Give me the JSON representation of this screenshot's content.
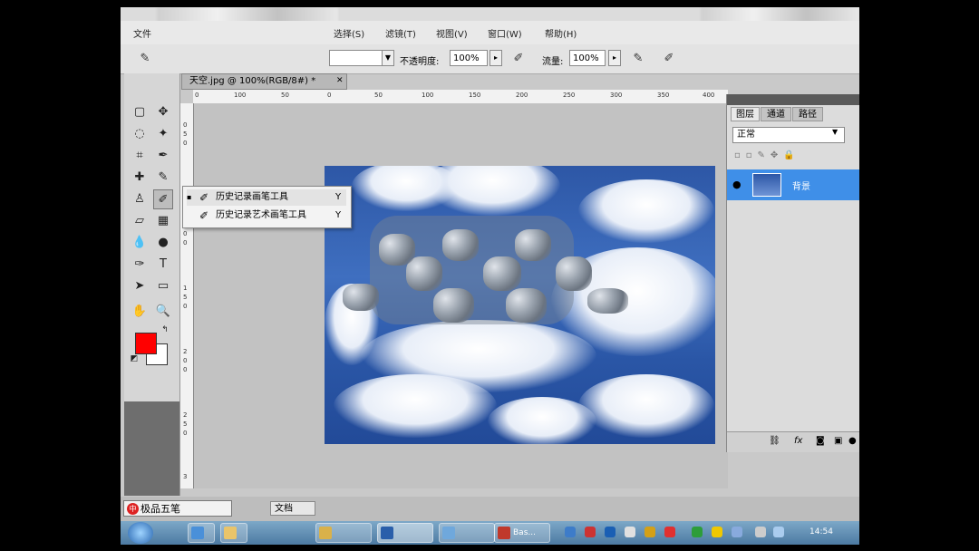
{
  "menu": {
    "items": [
      "文件",
      "选择(S)",
      "滤镜(T)",
      "视图(V)",
      "窗口(W)",
      "帮助(H)"
    ]
  },
  "options": {
    "opacity_label": "不透明度:",
    "opacity_value": "100%",
    "flow_label": "流量:",
    "flow_value": "100%"
  },
  "document": {
    "tab_title": "天空.jpg @ 100%(RGB/8#) *",
    "ruler_h": [
      "0",
      "100",
      "50",
      "0",
      "50",
      "100",
      "150",
      "200",
      "250",
      "300",
      "350",
      "400"
    ],
    "ruler_v": [
      "0",
      "5",
      "0",
      "1",
      "0",
      "0",
      "1",
      "5",
      "0",
      "2",
      "0",
      "0",
      "2",
      "5",
      "0",
      "3"
    ]
  },
  "flyout": {
    "items": [
      {
        "label": "历史记录画笔工具",
        "key": "Y",
        "checked": true
      },
      {
        "label": "历史记录艺术画笔工具",
        "key": "Y",
        "checked": false
      }
    ]
  },
  "layers_panel": {
    "tabs": [
      "图层",
      "通道",
      "路径"
    ],
    "blend_mode": "正常",
    "layer_name": "背景",
    "bottom_icons": [
      "link-icon",
      "fx-icon",
      "mask-icon",
      "new-layer-icon",
      "delete-icon"
    ]
  },
  "status": {
    "ime_text": "极品五笔",
    "doc_tab": "文档"
  },
  "taskbar": {
    "buttons": [
      "",
      "",
      "",
      "",
      "Bas..."
    ],
    "clock": "14:54"
  },
  "colors": {
    "foreground": "#ff0000",
    "background": "#ffffff",
    "selection": "#3f8fe8"
  }
}
